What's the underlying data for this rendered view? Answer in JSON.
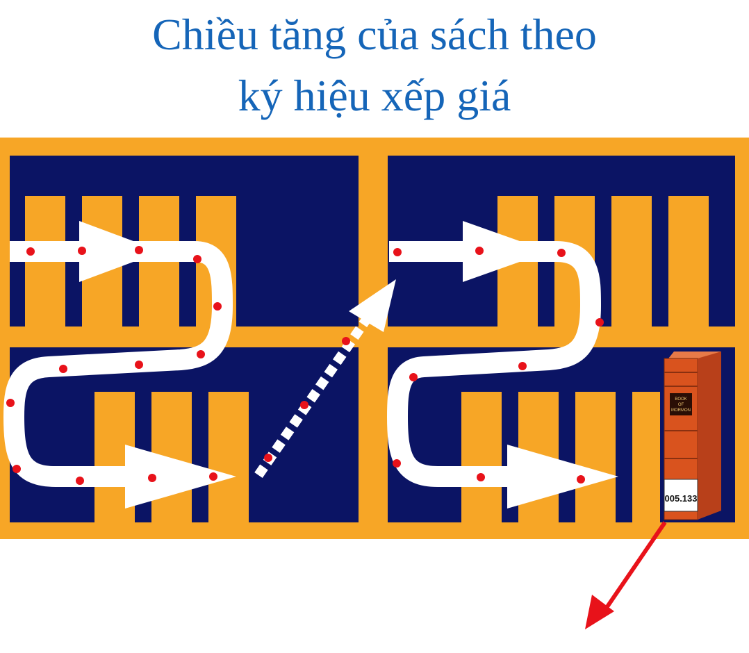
{
  "title": {
    "line1": "Chiều tăng của sách theo",
    "line2": "ký hiệu xếp giá"
  },
  "book": {
    "spine_text_line1": "BOOK",
    "spine_text_line2": "OF",
    "spine_text_line3": "MORMON",
    "call_number": "005.133"
  },
  "colors": {
    "title": "#1565b8",
    "background_frame": "#f7a626",
    "shelf_panel": "#0b1464",
    "path": "#ffffff",
    "dot": "#e8121a",
    "book": "#d9531e",
    "pointer_arrow": "#e8121a"
  }
}
